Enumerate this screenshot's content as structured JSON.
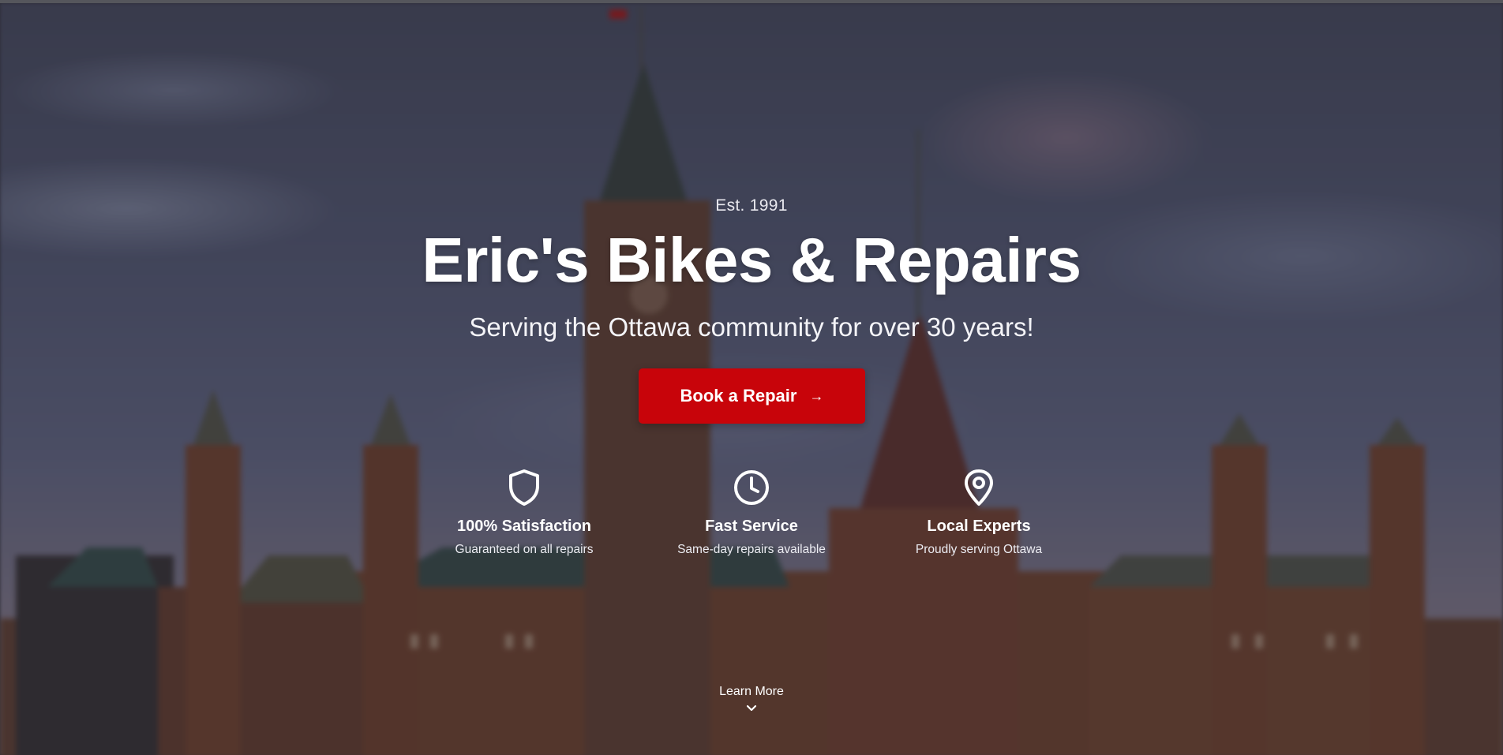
{
  "hero": {
    "est": "Est. 1991",
    "title": "Eric's Bikes & Repairs",
    "subtitle": "Serving the Ottawa community for over 30 years!",
    "cta_label": "Book a Repair",
    "cta_arrow": "→",
    "accent_color": "#c8040a"
  },
  "features": [
    {
      "icon": "shield-icon",
      "title": "100% Satisfaction",
      "description": "Guaranteed on all repairs"
    },
    {
      "icon": "clock-icon",
      "title": "Fast Service",
      "description": "Same-day repairs available"
    },
    {
      "icon": "map-pin-icon",
      "title": "Local Experts",
      "description": "Proudly serving Ottawa"
    }
  ],
  "learn_more": {
    "label": "Learn More",
    "icon": "chevron-down-icon"
  }
}
